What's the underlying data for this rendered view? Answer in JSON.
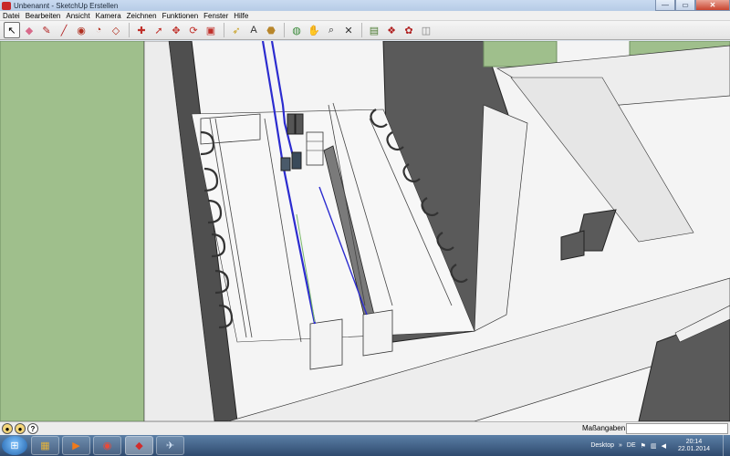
{
  "window": {
    "title": "Unbenannt - SketchUp Erstellen",
    "minimize": "—",
    "maximize": "▭",
    "close": "✕"
  },
  "menu": [
    "Datei",
    "Bearbeiten",
    "Ansicht",
    "Kamera",
    "Zeichnen",
    "Funktionen",
    "Fenster",
    "Hilfe"
  ],
  "toolbar": {
    "tools": [
      {
        "name": "select-tool-icon",
        "glyph": "↖",
        "active": true
      },
      {
        "name": "eraser-tool-icon",
        "glyph": "◆",
        "color": "#d86a8a"
      },
      {
        "name": "pencil-tool-icon",
        "glyph": "✎",
        "color": "#b02020"
      },
      {
        "name": "line-tool-icon",
        "glyph": "╱",
        "color": "#b02020"
      },
      {
        "name": "circle-tool-icon",
        "glyph": "◉",
        "color": "#b03020"
      },
      {
        "name": "arc-tool-icon",
        "glyph": "◔",
        "color": "#b03020"
      },
      {
        "name": "rectangle-tool-icon",
        "glyph": "◇",
        "color": "#b03020"
      },
      {
        "sep": true
      },
      {
        "name": "push-pull-tool-icon",
        "glyph": "✚",
        "color": "#c0302a"
      },
      {
        "name": "follow-me-tool-icon",
        "glyph": "➚",
        "color": "#c0302a"
      },
      {
        "name": "move-tool-icon",
        "glyph": "✥",
        "color": "#c0302a"
      },
      {
        "name": "rotate-tool-icon",
        "glyph": "⟳",
        "color": "#c0302a"
      },
      {
        "name": "scale-tool-icon",
        "glyph": "▣",
        "color": "#c0302a"
      },
      {
        "sep": true
      },
      {
        "name": "tape-measure-icon",
        "glyph": "➶",
        "color": "#c8a020"
      },
      {
        "name": "text-tool-icon",
        "glyph": "A",
        "color": "#303030"
      },
      {
        "name": "paint-bucket-icon",
        "glyph": "⬣",
        "color": "#b8862b"
      },
      {
        "sep": true
      },
      {
        "name": "orbit-tool-icon",
        "glyph": "◍",
        "color": "#3a8a3a"
      },
      {
        "name": "pan-tool-icon",
        "glyph": "✋",
        "color": "#505050"
      },
      {
        "name": "zoom-tool-icon",
        "glyph": "⌕",
        "color": "#303030"
      },
      {
        "name": "zoom-extents-icon",
        "glyph": "✕",
        "color": "#303030"
      },
      {
        "sep": true
      },
      {
        "name": "warehouse-icon",
        "glyph": "▤",
        "color": "#4a7a30"
      },
      {
        "name": "components-icon",
        "glyph": "❖",
        "color": "#b02020"
      },
      {
        "name": "extension-icon",
        "glyph": "✿",
        "color": "#b02020"
      },
      {
        "name": "send-layout-icon",
        "glyph": "◫",
        "color": "#808080"
      }
    ]
  },
  "status": {
    "measure_label": "Maßangaben",
    "measure_value": ""
  },
  "taskbar": {
    "apps": [
      {
        "name": "taskbar-explorer-icon",
        "glyph": "▦",
        "color": "#e3b23c"
      },
      {
        "name": "taskbar-mediaplayer-icon",
        "glyph": "▶",
        "color": "#f07a1a"
      },
      {
        "name": "taskbar-chrome-icon",
        "glyph": "◉",
        "color": "#e84a3a"
      },
      {
        "name": "taskbar-sketchup-icon",
        "glyph": "◆",
        "color": "#d22c2c",
        "active": true
      },
      {
        "name": "taskbar-app-icon",
        "glyph": "✈",
        "color": "#cfe0f3"
      }
    ],
    "desktop_label": "Desktop",
    "lang": "DE",
    "time": "20:14",
    "date": "22.01.2014"
  }
}
